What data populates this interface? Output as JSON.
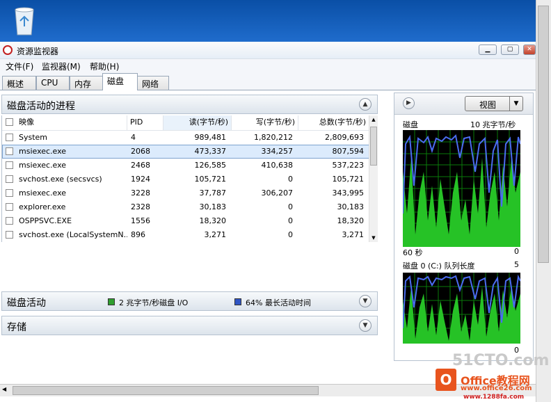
{
  "window": {
    "title": "资源监视器"
  },
  "menu": [
    "文件(F)",
    "监视器(M)",
    "帮助(H)"
  ],
  "tabs": [
    {
      "label": "概述",
      "active": false
    },
    {
      "label": "CPU",
      "active": false
    },
    {
      "label": "内存",
      "active": false
    },
    {
      "label": "磁盘",
      "active": true
    },
    {
      "label": "网络",
      "active": false
    }
  ],
  "processes": {
    "title": "磁盘活动的进程",
    "columns": [
      "映像",
      "PID",
      "读(字节/秒)",
      "写(字节/秒)",
      "总数(字节/秒)"
    ],
    "sorted_column": "读(字节/秒)",
    "rows": [
      {
        "image": "System",
        "pid": "4",
        "read": "989,481",
        "write": "1,820,212",
        "total": "2,809,693",
        "selected": false
      },
      {
        "image": "msiexec.exe",
        "pid": "2068",
        "read": "473,337",
        "write": "334,257",
        "total": "807,594",
        "selected": true
      },
      {
        "image": "msiexec.exe",
        "pid": "2468",
        "read": "126,585",
        "write": "410,638",
        "total": "537,223",
        "selected": false
      },
      {
        "image": "svchost.exe (secsvcs)",
        "pid": "1924",
        "read": "105,721",
        "write": "0",
        "total": "105,721",
        "selected": false
      },
      {
        "image": "msiexec.exe",
        "pid": "3228",
        "read": "37,787",
        "write": "306,207",
        "total": "343,995",
        "selected": false
      },
      {
        "image": "explorer.exe",
        "pid": "2328",
        "read": "30,183",
        "write": "0",
        "total": "30,183",
        "selected": false
      },
      {
        "image": "OSPPSVC.EXE",
        "pid": "1556",
        "read": "18,320",
        "write": "0",
        "total": "18,320",
        "selected": false
      },
      {
        "image": "svchost.exe (LocalSystemN...",
        "pid": "896",
        "read": "3,271",
        "write": "0",
        "total": "3,271",
        "selected": false
      }
    ]
  },
  "disk_activity": {
    "title": "磁盘活动",
    "io_legend": "2 兆字节/秒磁盘 I/O",
    "active_time_legend": "64% 最长活动时间",
    "io_color": "#2e9e2e",
    "active_color": "#2f55c4"
  },
  "storage": {
    "title": "存储"
  },
  "right_panel": {
    "view_button": "视图",
    "graph1": {
      "label": "磁盘",
      "scale": "10 兆字节/秒",
      "time": "60 秒",
      "min": "0"
    },
    "graph2": {
      "label": "磁盘 0 (C:) 队列长度",
      "scale": "5",
      "min": "0"
    }
  },
  "watermarks": {
    "site1": "51CTO.com",
    "site2": "Office教程网",
    "site2_url": "www.office26.com",
    "site3": "www.1288fa.com"
  }
}
